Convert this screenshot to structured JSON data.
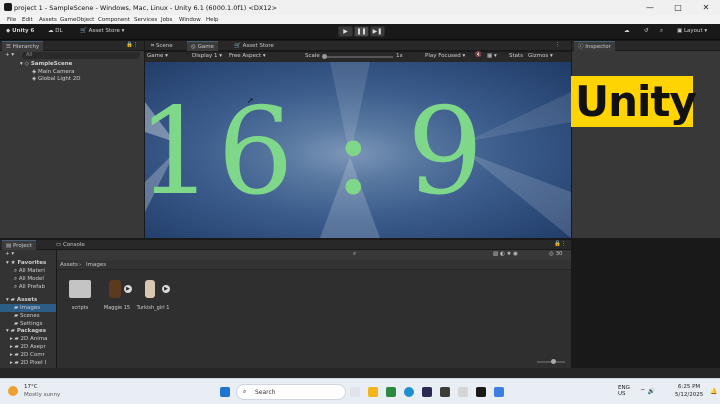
{
  "window": {
    "title": "project 1 - SampleScene - Windows, Mac, Linux - Unity 6.1 (6000.1.0f1) <DX12>",
    "controls": [
      "—",
      "□",
      "✕"
    ]
  },
  "menu": [
    "File",
    "Edit",
    "Assets",
    "GameObject",
    "Component",
    "Services",
    "Jobs",
    "Window",
    "Help"
  ],
  "toolbar": {
    "account": "Unity 6",
    "dl": "DL",
    "asset_store": "Asset Store",
    "layout": "Layout"
  },
  "hierarchy": {
    "tab": "Hierarchy",
    "search_placeholder": "All",
    "scene": "SampleScene",
    "items": [
      "Main Camera",
      "Global Light 2D"
    ]
  },
  "center_tabs": [
    "Scene",
    "Game",
    "Asset Store"
  ],
  "game_controls": {
    "mode": "Game",
    "display": "Display 1",
    "aspect": "Free Aspect",
    "scale_label": "Scale",
    "scale_value": "1x",
    "play_mode": "Play Focused",
    "stats": "Stats",
    "gizmos": "Gizmos"
  },
  "game_view": {
    "left": "16",
    "colon": ":",
    "right": "9"
  },
  "inspector": {
    "tab": "Inspector"
  },
  "overlay": {
    "banner_text": "Unity"
  },
  "project": {
    "tabs": [
      "Project",
      "Console"
    ],
    "favorites_label": "Favorites",
    "favorites": [
      "All Materi",
      "All Model",
      "All Prefab"
    ],
    "assets_label": "Assets",
    "assets_children": [
      "Images",
      "Scenes",
      "Settings"
    ],
    "packages_label": "Packages",
    "packages": [
      "2D Anima",
      "2D Asepr",
      "2D Comr",
      "2D Pixel I",
      "2D PSD Im"
    ],
    "breadcrumb": [
      "Assets",
      "Images"
    ],
    "count": "30",
    "files": [
      "scripts",
      "Maggie 15",
      "Turkish_girl 1"
    ]
  },
  "taskbar": {
    "weather_temp": "17°C",
    "weather_desc": "Mostly sunny",
    "search": "Search",
    "lang_top": "ENG",
    "lang_bottom": "US",
    "time": "6:25 PM",
    "date": "5/12/2025"
  }
}
